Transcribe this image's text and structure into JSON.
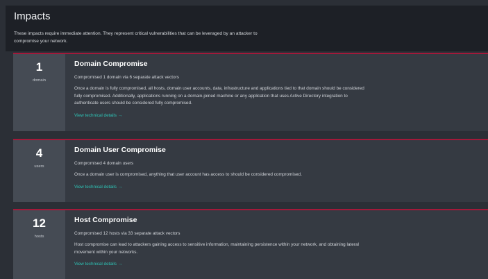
{
  "header": {
    "title": "Impacts",
    "description": "These impacts require immediate attention. They represent critical vulnerabilities that can be leveraged by an attacker to compromise your network."
  },
  "colors": {
    "accent_red": "#a3193a",
    "link_teal": "#2ec4b6"
  },
  "cards": [
    {
      "count": "1",
      "unit": "domain",
      "title": "Domain Compromise",
      "subtitle": "Compromised 1 domain via 6 separate attack vectors",
      "text": "Once a domain is fully compromised, all hosts, domain user accounts, data, infrastructure and applications tied to that domain should be considered fully compromised. Additionally, applications running on a domain-joined machine or any application that uses Active Directory integration to authenticate users should be considered fully compromised.",
      "link_label": "View technical details",
      "link_icon": "arrow-right-icon"
    },
    {
      "count": "4",
      "unit": "users",
      "title": "Domain User Compromise",
      "subtitle": "Compromised 4 domain users",
      "text": "Once a domain user is compromised, anything that user account has access to should be considered compromised.",
      "link_label": "View technical details",
      "link_icon": "arrow-right-icon"
    },
    {
      "count": "12",
      "unit": "hosts",
      "title": "Host Compromise",
      "subtitle": "Compromised 12 hosts via 33 separate attack vectors",
      "text": "Host compromise can lead to attackers gaining access to sensitive information, maintaining persistence within your network, and obtaining lateral movement within your networks.",
      "link_label": "View technical details",
      "link_icon": "arrow-right-icon"
    }
  ]
}
